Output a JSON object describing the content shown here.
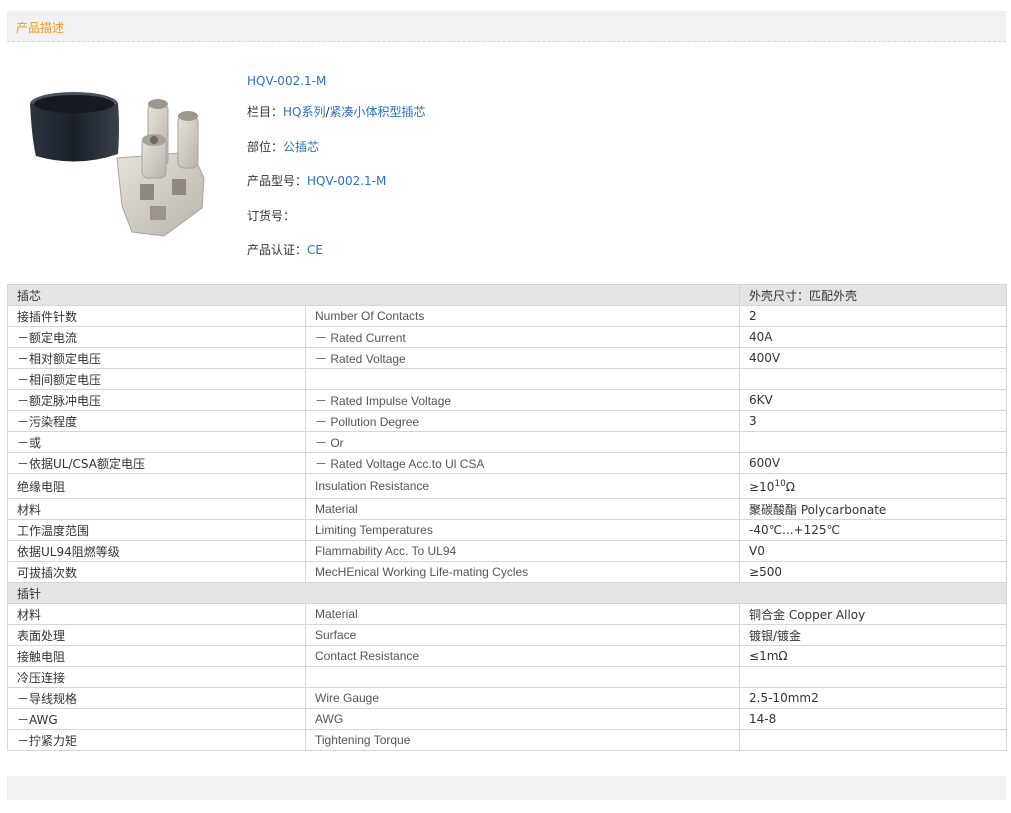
{
  "header": {
    "title": "产品描述"
  },
  "product": {
    "name": "HQV-002.1-M",
    "category_label": "栏目：",
    "category_link1": "HQ系列",
    "category_sep": "/",
    "category_link2": "紧凑小体积型插芯",
    "part_label": "部位：",
    "part_value": "公插芯",
    "model_label": "产品型号：",
    "model_value": "HQV-002.1-M",
    "order_label": "订货号：",
    "order_value": "",
    "cert_label": "产品认证：",
    "cert_value": "CE"
  },
  "table": {
    "group1": {
      "left": "插芯",
      "right": "外壳尺寸：匹配外壳"
    },
    "rows1": [
      {
        "cn": "接插件针数",
        "en": "Number Of Contacts",
        "val": "2"
      },
      {
        "cn": "－额定电流",
        "en": "－ Rated Current",
        "val": "40A"
      },
      {
        "cn": "－相对额定电压",
        "en": "－ Rated Voltage",
        "val": "400V"
      },
      {
        "cn": "－相间额定电压",
        "en": "",
        "val": ""
      },
      {
        "cn": "－额定脉冲电压",
        "en": "－ Rated Impulse Voltage",
        "val": "6KV"
      },
      {
        "cn": "－污染程度",
        "en": "－ Pollution Degree",
        "val": "3"
      },
      {
        "cn": "－或",
        "en": "－ Or",
        "val": ""
      },
      {
        "cn": "－依据UL/CSA额定电压",
        "en": "－ Rated Voltage Acc.to Ul CSA",
        "val": "600V"
      }
    ],
    "insulation": {
      "cn": "绝缘电阻",
      "en": "Insulation Resistance",
      "val_pre": "≥10",
      "val_sup": "10",
      "val_post": "Ω"
    },
    "rows2": [
      {
        "cn": "材料",
        "en": "Material",
        "val": "聚碳酸酯 Polycarbonate"
      },
      {
        "cn": "工作温度范围",
        "en": "Limiting Temperatures",
        "val": "-40℃...+125℃"
      },
      {
        "cn": "依据UL94阻燃等级",
        "en": "Flammability Acc. To UL94",
        "val": "V0"
      },
      {
        "cn": "可拔插次数",
        "en": "MecHEnical Working Life-mating Cycles",
        "val": "≥500"
      }
    ],
    "group2": {
      "left": "插针"
    },
    "rows3": [
      {
        "cn": "材料",
        "en": "Material",
        "val": "铜合金 Copper Alloy"
      },
      {
        "cn": "表面处理",
        "en": "Surface",
        "val": "镀银/镀金"
      },
      {
        "cn": "接触电阻",
        "en": "Contact Resistance",
        "val": "≤1mΩ"
      },
      {
        "cn": "冷压连接",
        "en": "",
        "val": ""
      },
      {
        "cn": "－导线规格",
        "en": "Wire Gauge",
        "val": "2.5-10mm2"
      },
      {
        "cn": "－AWG",
        "en": "AWG",
        "val": "14-8"
      },
      {
        "cn": "－拧紧力矩",
        "en": "Tightening Torque",
        "val": ""
      }
    ]
  }
}
